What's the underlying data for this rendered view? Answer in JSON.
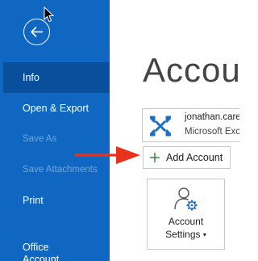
{
  "nav": {
    "items": [
      {
        "label": "Info"
      },
      {
        "label": "Open & Export"
      },
      {
        "label": "Save As"
      },
      {
        "label": "Save Attachments"
      },
      {
        "label": "Print"
      },
      {
        "label": "Office Account",
        "line1": "Office",
        "line2": "Account"
      }
    ],
    "active": "Info"
  },
  "main": {
    "title": "Accou",
    "account": {
      "name": "jonathan.care",
      "type": "Microsoft Exc"
    },
    "add_account_label": "Add Account",
    "settings": {
      "line1": "Account",
      "line2": "Settings",
      "caret": "▾"
    }
  },
  "colors": {
    "sidebar": "#0f67c2",
    "sidebar_active": "#0a4f9b",
    "disabled_text": "#6fa6de",
    "annotation_arrow": "#e8321e",
    "icon_blue": "#1d6fc4",
    "plus_green": "#2e7d32"
  },
  "icons": {
    "back": "back-arrow-circle-icon",
    "cursor": "mouse-pointer-icon",
    "exchange": "exchange-icon",
    "plus": "plus-icon",
    "arrow": "red-annotation-arrow-icon",
    "settings": "user-gear-icon"
  }
}
